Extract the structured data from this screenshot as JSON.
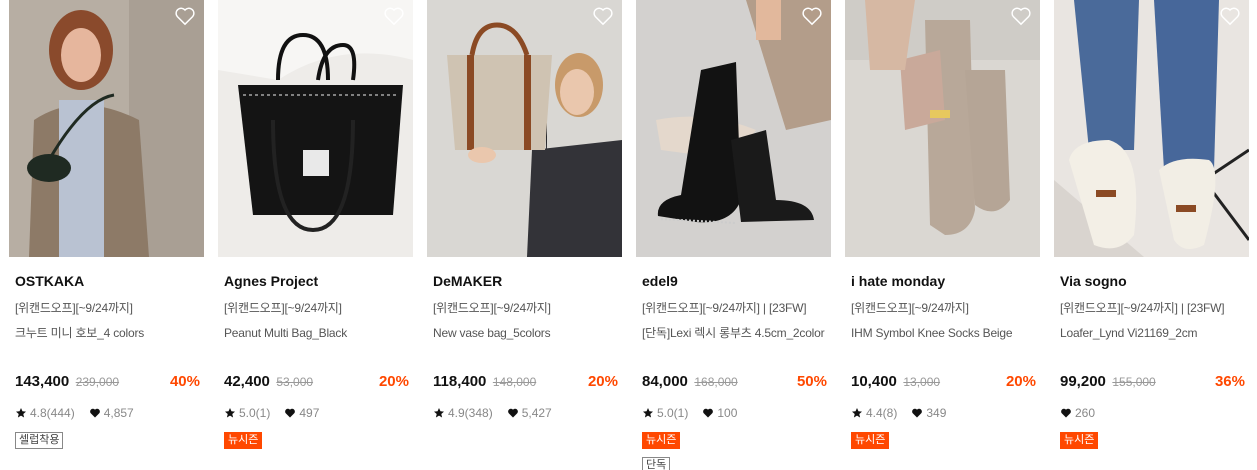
{
  "products": [
    {
      "brand": "OSTKAKA",
      "promo": "[위캔드오프][~9/24까지]",
      "name": "크누트 미니 호보_4 colors",
      "price": "143,400",
      "original_price": "239,000",
      "discount": "40%",
      "rating": "4.8(444)",
      "likes": "4,857",
      "badges": [
        {
          "text": "셀럽착용",
          "style": "outline"
        }
      ]
    },
    {
      "brand": "Agnes Project",
      "promo": "[위캔드오프][~9/24까지]",
      "name": "Peanut Multi Bag_Black",
      "price": "42,400",
      "original_price": "53,000",
      "discount": "20%",
      "rating": "5.0(1)",
      "likes": "497",
      "badges": [
        {
          "text": "뉴시즌",
          "style": "filled"
        }
      ]
    },
    {
      "brand": "DeMAKER",
      "promo": "[위캔드오프][~9/24까지]",
      "name": "New vase bag_5colors",
      "price": "118,400",
      "original_price": "148,000",
      "discount": "20%",
      "rating": "4.9(348)",
      "likes": "5,427",
      "badges": []
    },
    {
      "brand": "edel9",
      "promo": "[위캔드오프][~9/24까지] | [23FW]",
      "name": "[단독]Lexi 렉시 롱부츠 4.5cm_2color",
      "price": "84,000",
      "original_price": "168,000",
      "discount": "50%",
      "rating": "5.0(1)",
      "likes": "100",
      "badges": [
        {
          "text": "뉴시즌",
          "style": "filled"
        },
        {
          "text": "단독",
          "style": "outline"
        }
      ]
    },
    {
      "brand": "i hate monday",
      "promo": "[위캔드오프][~9/24까지]",
      "name": "IHM Symbol Knee Socks Beige",
      "price": "10,400",
      "original_price": "13,000",
      "discount": "20%",
      "rating": "4.4(8)",
      "likes": "349",
      "badges": [
        {
          "text": "뉴시즌",
          "style": "filled"
        }
      ]
    },
    {
      "brand": "Via sogno",
      "promo": "[위캔드오프][~9/24까지] | [23FW]",
      "name": "Loafer_Lynd Vi21169_2cm",
      "price": "99,200",
      "original_price": "155,000",
      "discount": "36%",
      "rating": null,
      "likes": "260",
      "badges": [
        {
          "text": "뉴시즌",
          "style": "filled"
        }
      ]
    }
  ],
  "icons": {
    "wishlist": "heart-outline-icon",
    "rating": "star-icon",
    "likes": "heart-filled-icon"
  },
  "colors": {
    "discount": "#ff4800",
    "badge_new_bg": "#ff4800",
    "brand_text": "#111111",
    "muted_text": "#888888"
  }
}
